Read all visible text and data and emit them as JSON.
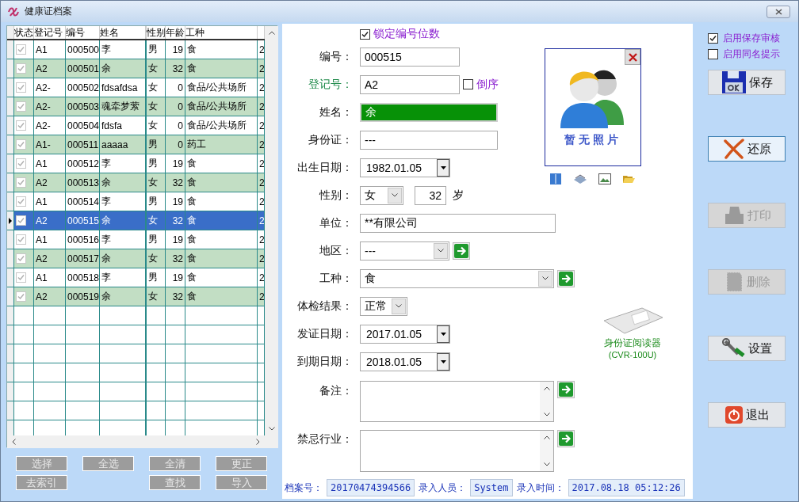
{
  "window": {
    "title": "健康证档案"
  },
  "grid": {
    "columns": [
      "状态",
      "登记号",
      "编号",
      "姓名",
      "性别",
      "年龄",
      "工种"
    ],
    "rows": [
      {
        "checked": true,
        "selected": false,
        "cells": [
          "",
          "A1",
          "000500",
          "李",
          "男",
          "19",
          "食",
          "2"
        ]
      },
      {
        "checked": true,
        "selected": false,
        "cells": [
          "",
          "A2",
          "000501",
          "余",
          "女",
          "32",
          "食",
          "2"
        ]
      },
      {
        "checked": true,
        "selected": false,
        "cells": [
          "",
          "A2-",
          "000502",
          "fdsafdsa",
          "女",
          "0",
          "食品/公共场所",
          "2"
        ]
      },
      {
        "checked": true,
        "selected": false,
        "cells": [
          "",
          "A2-",
          "000503",
          "魂牵梦萦",
          "女",
          "0",
          "食品/公共场所",
          "2"
        ]
      },
      {
        "checked": true,
        "selected": false,
        "cells": [
          "",
          "A2-",
          "000504",
          "fdsfa",
          "女",
          "0",
          "食品/公共场所",
          "2"
        ]
      },
      {
        "checked": true,
        "selected": false,
        "cells": [
          "",
          "A1-",
          "000511",
          "aaaaa",
          "男",
          "0",
          "药工",
          "2"
        ]
      },
      {
        "checked": true,
        "selected": false,
        "cells": [
          "",
          "A1",
          "000512",
          "李",
          "男",
          "19",
          "食",
          "2"
        ]
      },
      {
        "checked": true,
        "selected": false,
        "cells": [
          "",
          "A2",
          "000513",
          "余",
          "女",
          "32",
          "食",
          "2"
        ]
      },
      {
        "checked": true,
        "selected": false,
        "cells": [
          "",
          "A1",
          "000514",
          "李",
          "男",
          "19",
          "食",
          "2"
        ]
      },
      {
        "checked": true,
        "selected": true,
        "cells": [
          "",
          "A2",
          "000515",
          "余",
          "女",
          "32",
          "食",
          "2"
        ]
      },
      {
        "checked": true,
        "selected": false,
        "cells": [
          "",
          "A1",
          "000516",
          "李",
          "男",
          "19",
          "食",
          "2"
        ]
      },
      {
        "checked": true,
        "selected": false,
        "cells": [
          "",
          "A2",
          "000517",
          "余",
          "女",
          "32",
          "食",
          "2"
        ]
      },
      {
        "checked": true,
        "selected": false,
        "cells": [
          "",
          "A1",
          "000518",
          "李",
          "男",
          "19",
          "食",
          "2"
        ]
      },
      {
        "checked": true,
        "selected": false,
        "cells": [
          "",
          "A2",
          "000519",
          "余",
          "女",
          "32",
          "食",
          "2"
        ]
      }
    ]
  },
  "grid_buttons": {
    "row_1": [
      "选择",
      "全选",
      "全清",
      "更正"
    ],
    "row_2": [
      "去索引",
      "查找",
      "导入"
    ]
  },
  "form": {
    "lock_digits": {
      "label": "锁定编号位数",
      "checked": true
    },
    "number": {
      "label": "编号：",
      "value": "000515",
      "focused": false
    },
    "reg_no": {
      "label": "登记号：",
      "value": "A2",
      "focused": false,
      "reverse": {
        "label": "倒序",
        "checked": false
      }
    },
    "name": {
      "label": "姓名：",
      "value": "余",
      "focused": true
    },
    "id_card": {
      "label": "身份证：",
      "value": "---",
      "focused": false
    },
    "birth_date": {
      "label": "出生日期：",
      "value": "1982.01.05"
    },
    "sex": {
      "label": "性别：",
      "value": "女",
      "age": "32",
      "age_unit": "岁"
    },
    "employer": {
      "label": "单位：",
      "value": "**有限公司",
      "focused": false
    },
    "region": {
      "label": "地区：",
      "value": "---"
    },
    "job": {
      "label": "工种：",
      "value": "食"
    },
    "exam_result": {
      "label": "体检结果：",
      "value": "正常"
    },
    "issue_date": {
      "label": "发证日期：",
      "value": "2017.01.05"
    },
    "expiry_date": {
      "label": "到期日期：",
      "value": "2018.01.05"
    },
    "remarks": {
      "label": "备注："
    },
    "banned_trades": {
      "label": "禁忌行业："
    }
  },
  "photo": {
    "caption": "暂无照片"
  },
  "card_reader": {
    "title": "身份证阅读器",
    "model": "(CVR-100U)"
  },
  "record_bar": [
    {
      "label": "档案号：",
      "value": "20170474394566"
    },
    {
      "label": "录入人员：",
      "value": "System"
    },
    {
      "label": "录入时间：",
      "value": "2017.08.18 05:12:26"
    }
  ],
  "options": [
    {
      "label": "启用保存审核",
      "checked": true
    },
    {
      "label": "启用同名提示",
      "checked": false
    }
  ],
  "actions": [
    {
      "label": "保存",
      "kind": "save",
      "disabled": false,
      "focused": false
    },
    {
      "label": "还原",
      "kind": "undo",
      "disabled": false,
      "focused": true
    },
    {
      "label": "打印",
      "kind": "print",
      "disabled": true,
      "focused": false
    },
    {
      "label": "删除",
      "kind": "delete",
      "disabled": true,
      "focused": false
    },
    {
      "label": "设置",
      "kind": "settings",
      "disabled": false,
      "focused": false
    },
    {
      "label": "退出",
      "kind": "exit",
      "disabled": false,
      "focused": false
    }
  ]
}
